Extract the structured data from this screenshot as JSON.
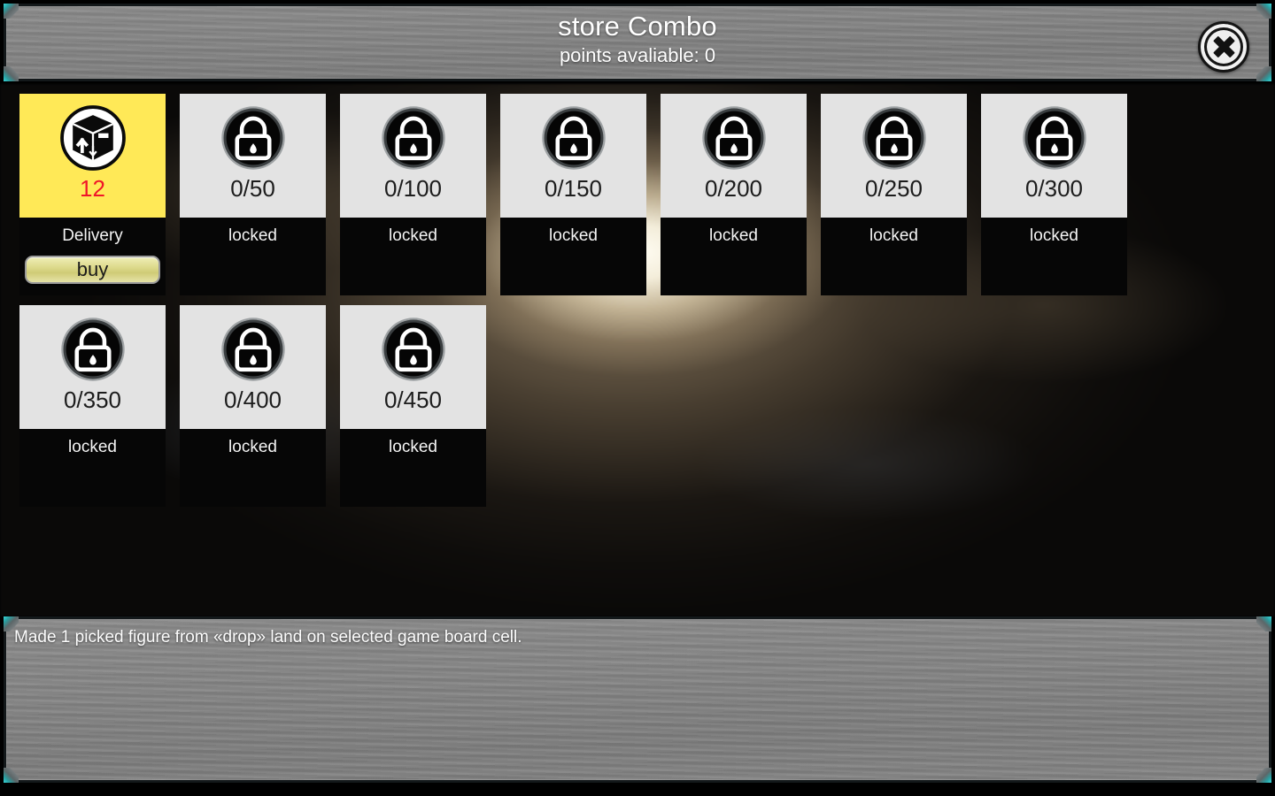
{
  "header": {
    "title": "store Combo",
    "points_label": "points avaliable: 0",
    "close_icon": "close-x-icon"
  },
  "colors": {
    "panel_gray": "#858585",
    "panel_border": "#13181a",
    "corner_accent": "#39d7d9",
    "unlocked_card_bg": "#ffe957",
    "locked_card_bg": "#e3e3e3",
    "card_bottom_bg": "#060606",
    "count_red": "#f01529",
    "buy_button": "#dcd98a"
  },
  "cards": [
    {
      "icon": "delivery-box-icon",
      "count": "12",
      "label": "Delivery",
      "state": "unlocked",
      "action": "buy"
    },
    {
      "icon": "lock-icon",
      "count": "0/50",
      "label": "locked",
      "state": "locked"
    },
    {
      "icon": "lock-icon",
      "count": "0/100",
      "label": "locked",
      "state": "locked"
    },
    {
      "icon": "lock-icon",
      "count": "0/150",
      "label": "locked",
      "state": "locked"
    },
    {
      "icon": "lock-icon",
      "count": "0/200",
      "label": "locked",
      "state": "locked"
    },
    {
      "icon": "lock-icon",
      "count": "0/250",
      "label": "locked",
      "state": "locked"
    },
    {
      "icon": "lock-icon",
      "count": "0/300",
      "label": "locked",
      "state": "locked"
    },
    {
      "icon": "lock-icon",
      "count": "0/350",
      "label": "locked",
      "state": "locked"
    },
    {
      "icon": "lock-icon",
      "count": "0/400",
      "label": "locked",
      "state": "locked"
    },
    {
      "icon": "lock-icon",
      "count": "0/450",
      "label": "locked",
      "state": "locked"
    }
  ],
  "description": {
    "text": "Made 1 picked figure from «drop» land on selected game board cell."
  }
}
